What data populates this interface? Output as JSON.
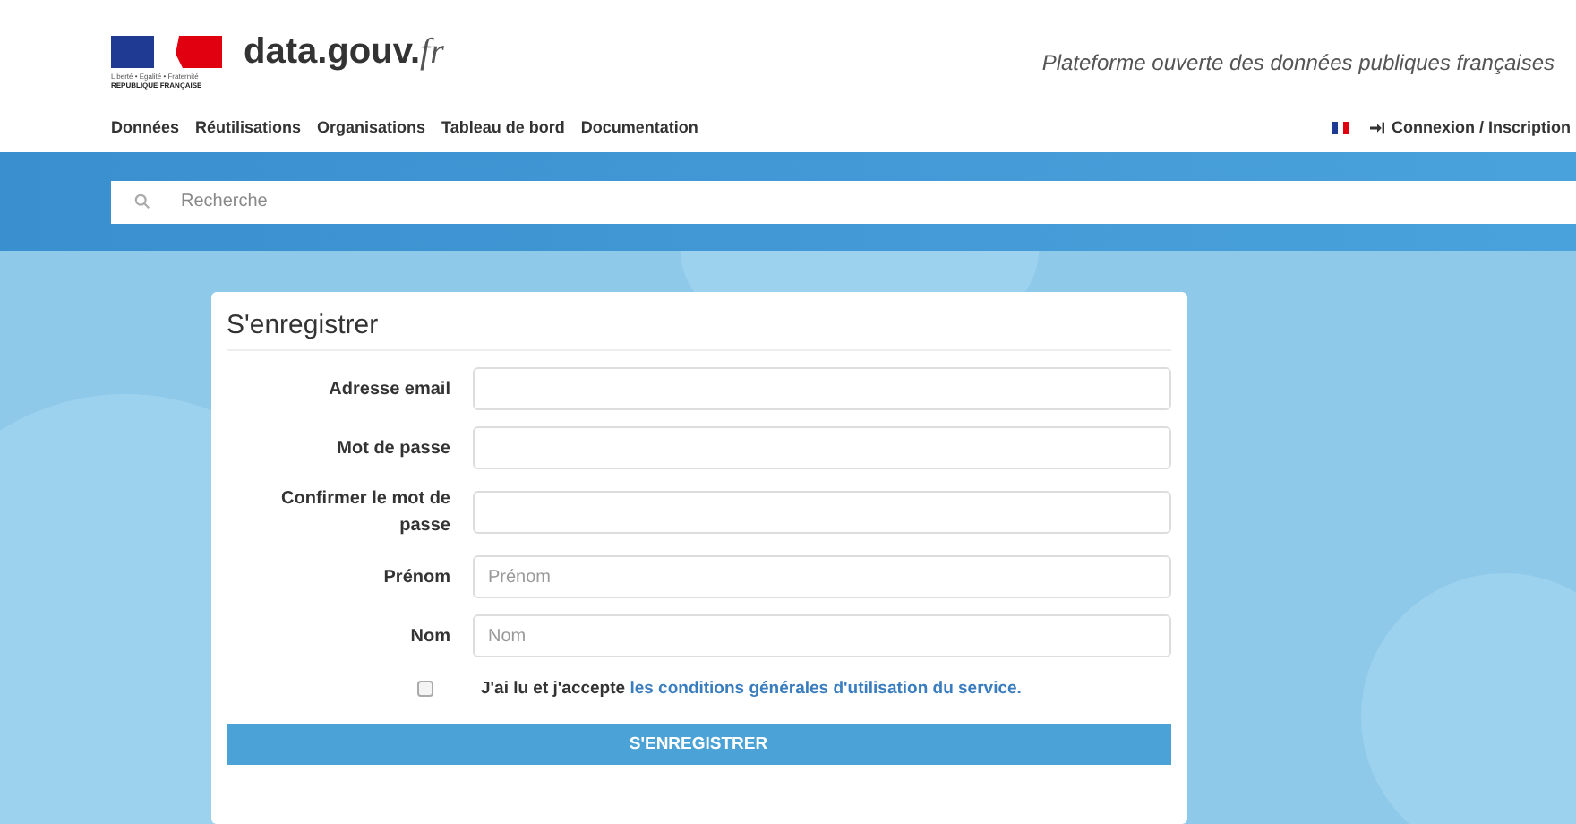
{
  "logo": {
    "motto": "Liberté • Égalité • Fraternité",
    "republic": "RÉPUBLIQUE FRANÇAISE"
  },
  "site": {
    "name": "data.gouv.",
    "suffix": "fr",
    "tagline": "Plateforme ouverte des données publiques françaises"
  },
  "nav": [
    "Données",
    "Réutilisations",
    "Organisations",
    "Tableau de bord",
    "Documentation"
  ],
  "login": "Connexion / Inscription",
  "search": {
    "placeholder": "Recherche"
  },
  "form": {
    "title": "S'enregistrer",
    "fields": [
      {
        "label": "Adresse email"
      },
      {
        "label": "Mot de passe"
      },
      {
        "label": "Confirmer le mot de passe"
      },
      {
        "label": "Prénom",
        "placeholder": "Prénom"
      },
      {
        "label": "Nom",
        "placeholder": "Nom"
      }
    ],
    "terms": {
      "checked": false,
      "text": "J'ai lu et j'accepte",
      "link": "les conditions générales d'utilisation du service."
    },
    "submit": "S'ENREGISTRER"
  }
}
